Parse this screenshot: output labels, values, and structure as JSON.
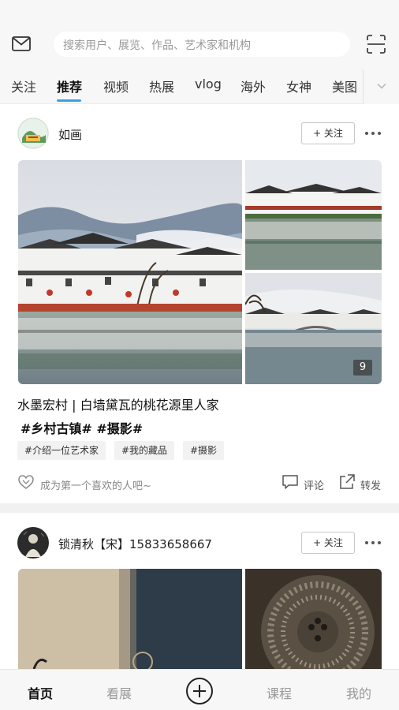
{
  "search": {
    "placeholder": "搜索用户、展览、作品、艺术家和机构"
  },
  "icons": {
    "mail": "mail-icon",
    "scan": "scan-icon",
    "more": "chevron-down-icon"
  },
  "tabs": [
    {
      "label": "关注",
      "active": false
    },
    {
      "label": "推荐",
      "active": true
    },
    {
      "label": "视频",
      "active": false
    },
    {
      "label": "热展",
      "active": false
    },
    {
      "label": "vlog",
      "active": false
    },
    {
      "label": "海外",
      "active": false
    },
    {
      "label": "女神",
      "active": false
    },
    {
      "label": "美图",
      "active": false
    }
  ],
  "posts": [
    {
      "author": "如画",
      "follow_label": "+ 关注",
      "image_count": "9",
      "title": "水墨宏村 | 白墙黛瓦的桃花源里人家",
      "tags_line": "#乡村古镇# #摄影#",
      "chips": [
        "#介绍一位艺术家",
        "#我的藏品",
        "#摄影"
      ],
      "like_text": "成为第一个喜欢的人吧~",
      "comment_label": "评论",
      "share_label": "转发"
    },
    {
      "author": "锁清秋【宋】15833658667",
      "follow_label": "+ 关注"
    }
  ],
  "bottom_nav": [
    {
      "label": "首页",
      "active": true
    },
    {
      "label": "看展",
      "active": false
    },
    {
      "label": "课程",
      "active": false
    },
    {
      "label": "我的",
      "active": false
    }
  ],
  "colors": {
    "accent": "#3aa0e8",
    "background": "#f7f7f7"
  }
}
